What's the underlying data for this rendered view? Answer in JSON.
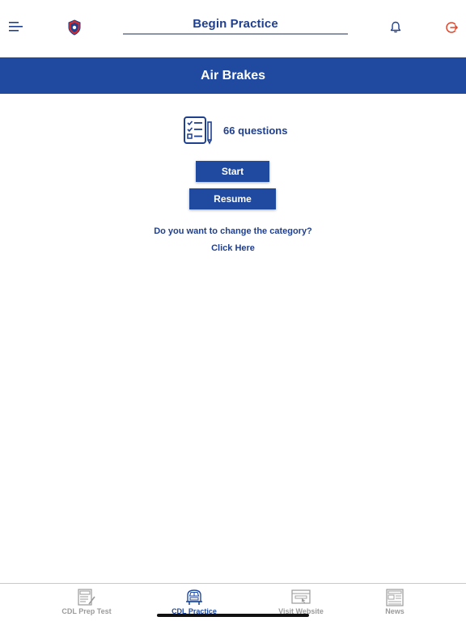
{
  "header": {
    "title": "Begin Practice",
    "icons": {
      "menu": "menu-icon",
      "logo": "shield-logo-icon",
      "notifications": "bell-icon",
      "logout": "logout-icon"
    }
  },
  "banner": {
    "title": "Air Brakes"
  },
  "practice": {
    "question_count": "66 questions",
    "start_label": "Start",
    "resume_label": "Resume",
    "change_category_question": "Do you want to change the category?",
    "click_here_label": "Click Here"
  },
  "tabs": [
    {
      "label": "CDL Prep Test",
      "icon": "test-sheet-icon",
      "active": false
    },
    {
      "label": "CDL Practice",
      "icon": "truck-icon",
      "active": true
    },
    {
      "label": "Visit Website",
      "icon": "browser-icon",
      "active": false
    },
    {
      "label": "News",
      "icon": "newspaper-icon",
      "active": false
    }
  ],
  "colors": {
    "primary": "#1f4aa0",
    "text": "#1f3f8f",
    "logout": "#e0452a",
    "inactive_tab": "#9a9a9a"
  }
}
